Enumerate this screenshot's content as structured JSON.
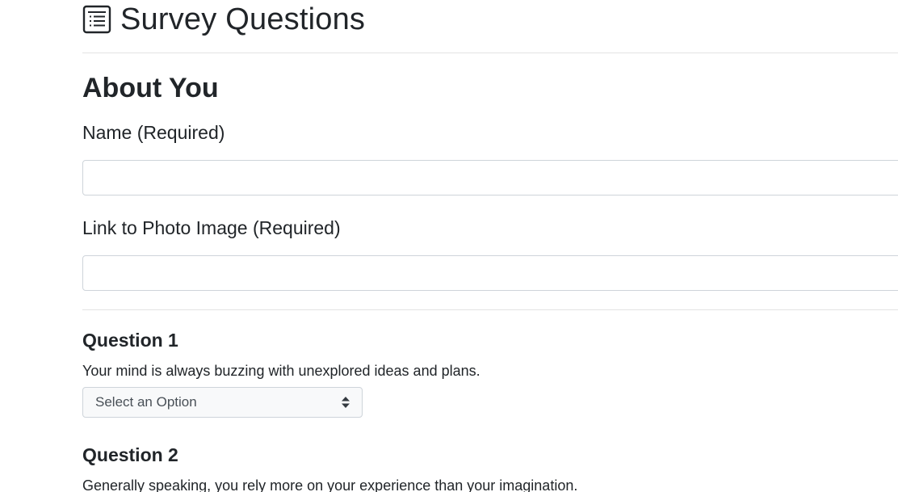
{
  "header": {
    "icon": "survey-list-icon",
    "title": "Survey Questions"
  },
  "about": {
    "heading": "About You",
    "name_label": "Name (Required)",
    "name_value": "",
    "photo_label": "Link to Photo Image (Required)",
    "photo_value": ""
  },
  "questions": [
    {
      "title": "Question 1",
      "text": "Your mind is always buzzing with unexplored ideas and plans.",
      "select_value": "Select an Option"
    },
    {
      "title": "Question 2",
      "text": "Generally speaking, you rely more on your experience than your imagination."
    }
  ],
  "colors": {
    "text": "#212529",
    "border": "#ced4da",
    "select_bg": "#f8f9fa",
    "divider": "#e3e3e3"
  }
}
